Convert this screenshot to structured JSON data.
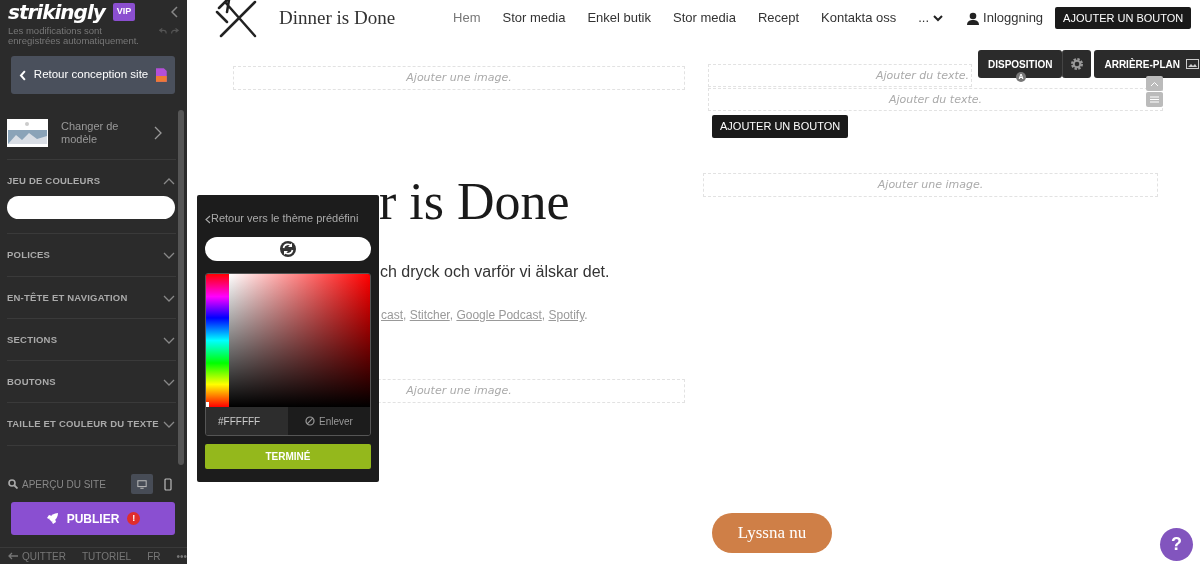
{
  "sidebar": {
    "logo": "strikingly",
    "badge": "VIP",
    "autosave_note": "Les modifications sont enregistrées automatiquement.",
    "back_button": "Retour conception site",
    "template_label": "Changer de modèle",
    "sections": [
      {
        "title": "JEU DE COULEURS",
        "expanded": true
      },
      {
        "title": "POLICES",
        "expanded": false
      },
      {
        "title": "EN-TÊTE ET NAVIGATION",
        "expanded": false
      },
      {
        "title": "SECTIONS",
        "expanded": false
      },
      {
        "title": "BOUTONS",
        "expanded": false
      },
      {
        "title": "TAILLE ET COULEUR DU TEXTE",
        "expanded": false
      }
    ],
    "preview_label": "APERÇU DU SITE",
    "devices": [
      {
        "kind": "desktop",
        "selected": true
      },
      {
        "kind": "mobile",
        "selected": false
      }
    ],
    "publish": {
      "label": "PUBLIER",
      "alert": "!"
    },
    "footer": [
      {
        "label": "QUITTER",
        "kind": "back"
      },
      {
        "label": "TUTORIEL",
        "kind": "link"
      },
      {
        "label": "FR",
        "kind": "link"
      },
      {
        "label": "•••",
        "kind": "link"
      }
    ]
  },
  "color_popup": {
    "back": "Retour vers le thème prédéfini",
    "hue": {
      "level": 0
    },
    "hex": "#FFFFFF",
    "remove": "Enlever",
    "done": "TERMINÉ"
  },
  "site": {
    "title": "Dinner is Done",
    "nav": [
      {
        "label": "Hem",
        "selected": true
      },
      {
        "label": "Stor media",
        "selected": false
      },
      {
        "label": "Enkel butik",
        "selected": false
      },
      {
        "label": "Stor media",
        "selected": false
      },
      {
        "label": "Recept",
        "selected": false
      },
      {
        "label": "Kontakta oss",
        "selected": false
      },
      {
        "label": "...",
        "selected": false
      }
    ],
    "login": "Inloggning",
    "header_button": "AJOUTER UN BOUTON",
    "toolbar": {
      "layout": "DISPOSITION",
      "shortcut": "A",
      "background": "ARRIÈRE-PLAN"
    },
    "left": {
      "top_image": "Ajouter une image.",
      "heading": "r is Done",
      "tagline": "ch dryck och varför vi älskar det.",
      "links": [
        "cast",
        "Stitcher",
        "Google Podcast",
        "Spotify"
      ],
      "link_separator": ", ",
      "links_end": ".",
      "bottom_image": "Ajouter une image."
    },
    "right": {
      "text_placeholders": [
        "Ajouter du texte.",
        "Ajouter du texte."
      ],
      "button": "AJOUTER UN BOUTON",
      "image": "Ajouter une image.",
      "cta": "Lyssna nu"
    },
    "help": "?"
  }
}
